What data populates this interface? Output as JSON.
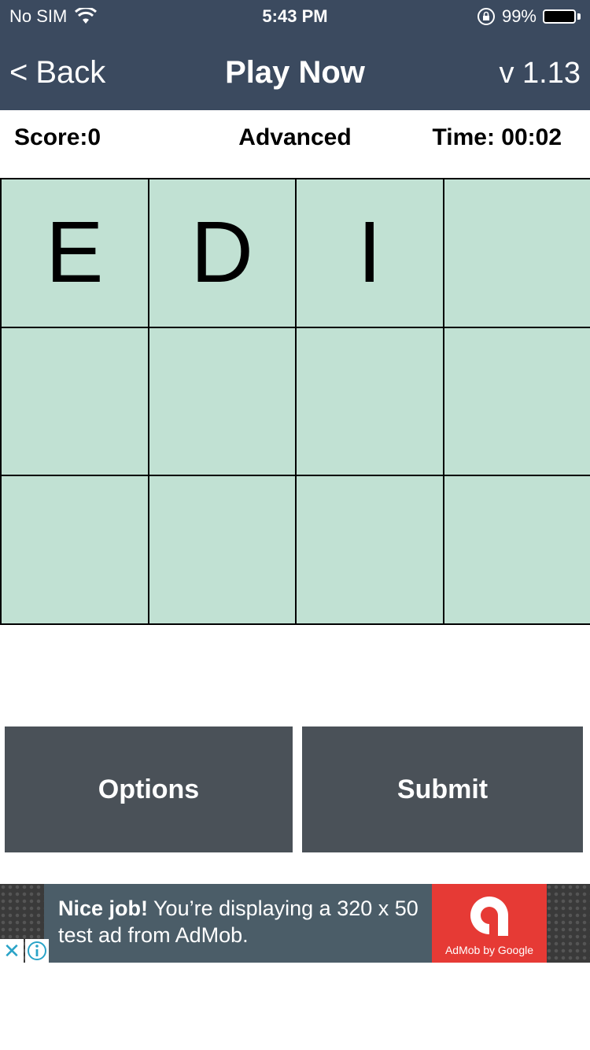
{
  "status_bar": {
    "carrier": "No SIM",
    "time": "5:43 PM",
    "battery_percent": "99%",
    "battery_level": 0.99
  },
  "header": {
    "back_label": "Back",
    "back_chevron": "<",
    "title": "Play Now",
    "version": "v 1.13",
    "background_color": "#3b4a5f"
  },
  "info": {
    "score": "Score:0",
    "level": "Advanced",
    "time": "Time: 00:02"
  },
  "grid": {
    "cells": [
      "E",
      "D",
      "I",
      "",
      "",
      "",
      "",
      "",
      "",
      "",
      "",
      ""
    ],
    "cell_color": "#c1e1d3"
  },
  "buttons": {
    "options_label": "Options",
    "submit_label": "Submit"
  },
  "ad": {
    "headline": "Nice job!",
    "body_line1": " You’re displaying a 320 x 50",
    "body_line2": "test ad from AdMob.",
    "logo_text": "AdMob by Google",
    "close_glyph": "✕"
  }
}
